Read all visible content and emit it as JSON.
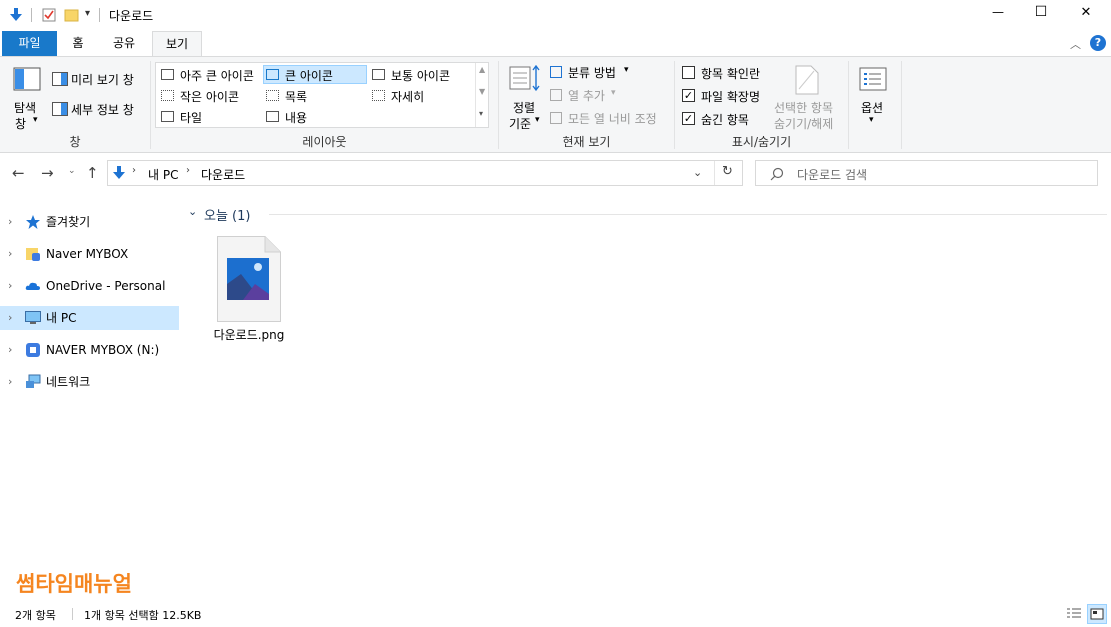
{
  "window": {
    "title": "다운로드",
    "minimize_glyph": "—",
    "maximize_glyph": "☐",
    "close_glyph": "✕"
  },
  "ribbon_tabs": [
    {
      "label": "파일",
      "state": "file"
    },
    {
      "label": "홈",
      "state": "normal"
    },
    {
      "label": "공유",
      "state": "normal"
    },
    {
      "label": "보기",
      "state": "active"
    }
  ],
  "ribbon": {
    "pane_group": {
      "nav_pane_label_line1": "탐색",
      "nav_pane_label_line2": "창",
      "preview_label": "미리 보기 창",
      "details_label": "세부 정보 창",
      "group_label": "창"
    },
    "layout_group": {
      "items": [
        "아주 큰 아이콘",
        "큰 아이콘",
        "보통 아이콘",
        "작은 아이콘",
        "목록",
        "자세히",
        "타일",
        "내용"
      ],
      "selected": "큰 아이콘",
      "group_label": "레이아웃"
    },
    "current_view_group": {
      "sort_label_line1": "정렬",
      "sort_label_line2": "기준",
      "group_by_label": "분류 방법",
      "add_columns_label": "열 추가",
      "size_columns_label": "모든 열 너비 조정",
      "group_label": "현재 보기"
    },
    "show_hide_group": {
      "item_checkboxes_label": "항목 확인란",
      "item_checkboxes_checked": false,
      "extensions_label": "파일 확장명",
      "extensions_checked": true,
      "hidden_items_label": "숨긴 항목",
      "hidden_items_checked": true,
      "hide_selected_line1": "선택한 항목",
      "hide_selected_line2": "숨기기/해제",
      "group_label": "표시/숨기기"
    },
    "options_label": "옵션"
  },
  "address": {
    "crumbs": [
      "내 PC",
      "다운로드"
    ],
    "search_placeholder": "다운로드 검색"
  },
  "nav_pane": {
    "items": [
      {
        "label": "즐겨찾기",
        "icon": "star-icon"
      },
      {
        "label": "Naver MYBOX",
        "icon": "mybox-folder-icon"
      },
      {
        "label": "OneDrive - Personal",
        "icon": "onedrive-icon"
      },
      {
        "label": "내 PC",
        "icon": "pc-icon",
        "selected": true
      },
      {
        "label": "NAVER MYBOX (N:)",
        "icon": "mybox-drive-icon"
      },
      {
        "label": "네트워크",
        "icon": "network-icon"
      }
    ]
  },
  "content": {
    "group_header": "오늘 (1)",
    "files": [
      {
        "name": "다운로드.png",
        "icon": "image-file-icon"
      }
    ]
  },
  "watermark": "썸타임매뉴얼",
  "status": {
    "item_count": "2개 항목",
    "selection": "1개 항목 선택함 12.5KB"
  },
  "colors": {
    "accent": "#1979ca",
    "selection": "#cce8ff",
    "watermark": "#f5851f"
  }
}
